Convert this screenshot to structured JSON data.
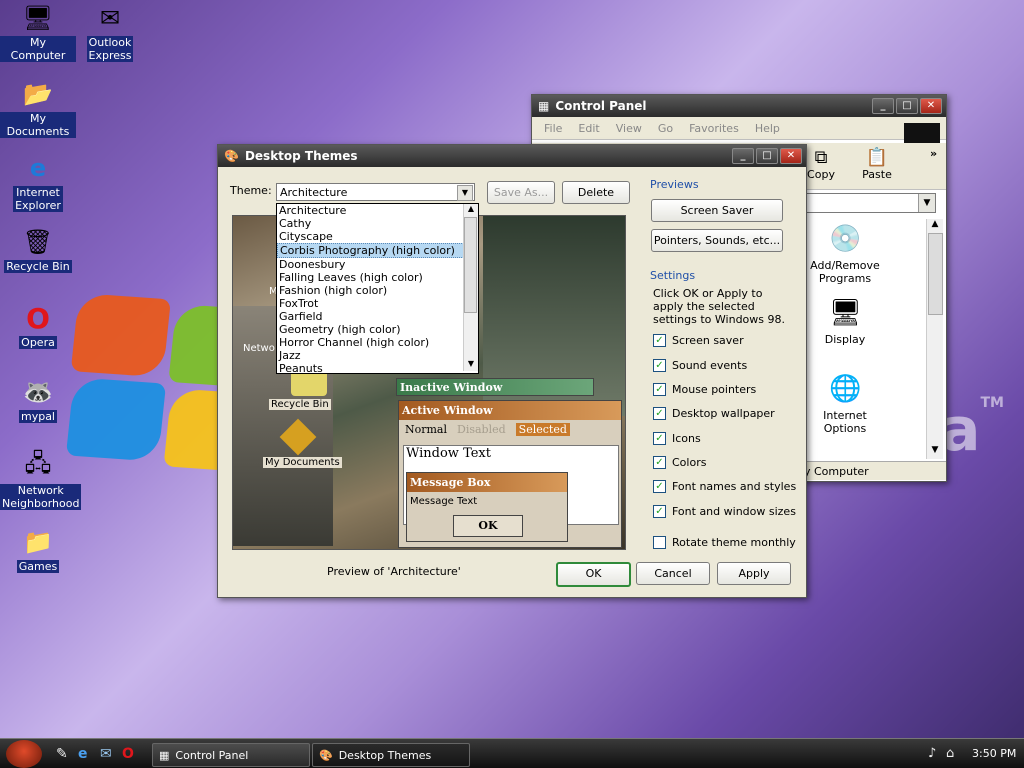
{
  "desktop": {
    "icons": [
      {
        "label": "My Computer",
        "icon": "computer-icon"
      },
      {
        "label": "Outlook\nExpress",
        "icon": "outlook-icon"
      },
      {
        "label": "My Documents",
        "icon": "folder-icon"
      },
      {
        "label": "Internet\nExplorer",
        "icon": "ie-icon"
      },
      {
        "label": "Recycle Bin",
        "icon": "recycle-bin-icon"
      },
      {
        "label": "Opera",
        "icon": "opera-icon"
      },
      {
        "label": "mypal",
        "icon": "raccoon-icon"
      },
      {
        "label": "Network\nNeighborhood",
        "icon": "network-icon"
      },
      {
        "label": "Games",
        "icon": "folder-icon"
      }
    ]
  },
  "control_panel": {
    "title": "Control Panel",
    "menu": [
      "File",
      "Edit",
      "View",
      "Go",
      "Favorites",
      "Help"
    ],
    "toolbar": {
      "copy": "Copy",
      "paste": "Paste",
      "more": "»"
    },
    "items": [
      "Add/Remove\nPrograms",
      "Display",
      "Internet\nOptions"
    ],
    "status": "y Computer"
  },
  "themes": {
    "title": "Desktop Themes",
    "theme_label": "Theme:",
    "theme_value": "Architecture",
    "save_as": "Save As...",
    "delete": "Delete",
    "dropdown": [
      "Architecture",
      "Cathy",
      "Cityscape",
      "Corbis Photography (high color)",
      "Doonesbury",
      "Falling Leaves (high color)",
      "Fashion (high color)",
      "FoxTrot",
      "Garfield",
      "Geometry (high color)",
      "Horror Channel (high color)",
      "Jazz",
      "Peanuts"
    ],
    "dropdown_selected_index": 3,
    "previews_heading": "Previews",
    "screen_saver_btn": "Screen Saver",
    "pointers_btn": "Pointers, Sounds, etc...",
    "settings_heading": "Settings",
    "settings_desc": "Click OK or Apply to apply the selected settings to Windows 98.",
    "checkboxes": [
      {
        "label": "Screen saver",
        "checked": true
      },
      {
        "label": "Sound events",
        "checked": true
      },
      {
        "label": "Mouse pointers",
        "checked": true
      },
      {
        "label": "Desktop wallpaper",
        "checked": true
      },
      {
        "label": "Icons",
        "checked": true
      },
      {
        "label": "Colors",
        "checked": true
      },
      {
        "label": "Font names and styles",
        "checked": true
      },
      {
        "label": "Font and window sizes",
        "checked": true
      },
      {
        "label": "Rotate theme monthly",
        "checked": false
      }
    ],
    "preview_caption": "Preview of 'Architecture'",
    "ok": "OK",
    "cancel": "Cancel",
    "apply": "Apply",
    "preview": {
      "inactive_title": "Inactive Window",
      "active_title": "Active Window",
      "menu_normal": "Normal",
      "menu_disabled": "Disabled",
      "menu_selected": "Selected",
      "window_text": "Window Text",
      "msgbox_title": "Message Box",
      "msgbox_text": "Message Text",
      "msgbox_ok": "OK",
      "icon_labels": [
        "Recycle Bin",
        "My Documents",
        "Netwo",
        "M"
      ]
    }
  },
  "taskbar": {
    "buttons": [
      "Control Panel",
      "Desktop Themes"
    ],
    "clock": "3:50 PM"
  }
}
